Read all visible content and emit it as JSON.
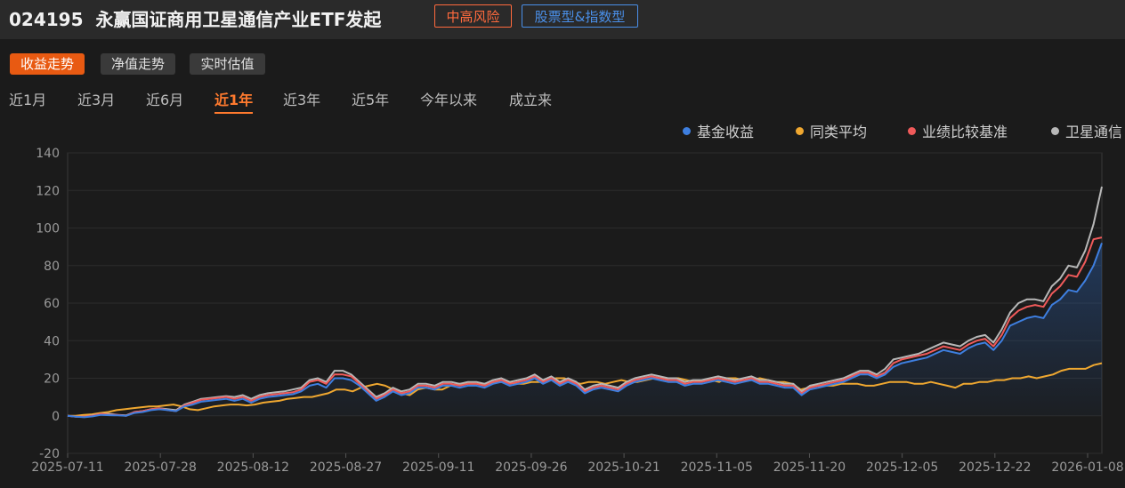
{
  "header": {
    "code": "024195",
    "name": "永赢国证商用卫星通信产业ETF发起",
    "risk_tag": "中高风险",
    "type_tag": "股票型&指数型"
  },
  "modes": [
    "收益走势",
    "净值走势",
    "实时估值"
  ],
  "active_mode": 0,
  "periods": [
    "近1月",
    "近3月",
    "近6月",
    "近1年",
    "近3年",
    "近5年",
    "今年以来",
    "成立来"
  ],
  "active_period": 3,
  "colors": {
    "fund": "#3e7fe0",
    "peer": "#f0a830",
    "benchmark": "#f05a5a",
    "index": "#b8b8b8",
    "accent": "#e85a12"
  },
  "chart_data": {
    "type": "line",
    "yticks": [
      -20,
      0,
      20,
      40,
      60,
      80,
      100,
      120,
      140
    ],
    "ylim": [
      -20,
      140
    ],
    "xticks": [
      "2025-07-11",
      "2025-07-28",
      "2025-08-12",
      "2025-08-27",
      "2025-09-11",
      "2025-09-26",
      "2025-10-21",
      "2025-11-05",
      "2025-11-20",
      "2025-12-05",
      "2025-12-22",
      "2026-01-08"
    ],
    "series": [
      {
        "name": "基金收益",
        "color": "#3e7fe0",
        "values": [
          0,
          -0.5,
          -0.8,
          -0.3,
          0.5,
          0.3,
          0.2,
          0,
          1.5,
          2,
          3,
          3.5,
          3,
          2.5,
          5,
          6,
          7.5,
          8,
          8.5,
          9,
          8,
          9,
          7,
          9,
          10,
          10.5,
          11,
          11.5,
          13,
          16,
          17,
          15,
          20,
          20,
          19,
          16,
          12,
          8,
          10,
          13,
          11,
          12,
          15,
          15,
          14,
          16,
          16,
          15,
          16,
          16,
          15,
          17,
          18,
          16,
          17,
          18,
          20,
          17,
          19,
          16,
          18,
          16,
          12,
          14,
          15,
          14,
          13,
          16,
          18,
          19,
          20,
          19,
          18,
          18,
          16,
          17,
          17,
          18,
          19,
          18,
          17,
          18,
          19,
          17,
          17,
          16,
          15,
          15,
          11,
          14,
          15,
          16,
          17,
          18,
          20,
          22,
          22,
          20,
          22,
          26,
          28,
          29,
          30,
          31,
          33,
          35,
          34,
          33,
          36,
          38,
          39,
          35,
          40,
          48,
          50,
          52,
          53,
          52,
          59,
          62,
          67,
          66,
          72,
          80,
          92
        ]
      },
      {
        "name": "同类平均",
        "color": "#f0a830",
        "values": [
          0,
          0,
          0.5,
          0.8,
          1.5,
          2,
          3,
          3.5,
          4,
          4.5,
          5,
          5,
          5.5,
          6,
          5,
          3.5,
          3,
          4,
          5,
          5.5,
          6,
          6,
          5.5,
          6,
          7,
          7.5,
          8,
          9,
          9.5,
          10,
          10,
          11,
          12,
          14,
          14,
          13,
          15,
          16,
          17,
          16,
          14,
          12,
          11,
          14,
          15,
          14,
          14,
          16,
          17,
          17,
          17,
          17,
          17,
          18,
          18,
          17,
          17,
          18,
          18,
          19,
          20,
          20,
          18,
          17,
          18,
          18,
          17,
          18,
          19,
          18,
          18,
          19,
          20,
          20,
          20,
          20,
          19,
          18,
          19,
          19,
          18,
          20,
          20,
          19,
          19,
          20,
          19,
          18,
          18,
          17,
          14,
          15,
          16,
          16,
          16,
          17,
          17,
          17,
          16,
          16,
          17,
          18,
          18,
          18,
          17,
          17,
          18,
          17,
          16,
          15,
          17,
          17,
          18,
          18,
          19,
          19,
          20,
          20,
          21,
          20,
          21,
          22,
          24,
          25,
          25,
          25,
          27,
          28
        ]
      },
      {
        "name": "业绩比较基准",
        "color": "#f05a5a",
        "values": [
          0,
          -0.5,
          -0.5,
          0,
          1,
          0.5,
          0.5,
          0,
          2,
          2.5,
          3.5,
          4,
          3,
          2.5,
          5.5,
          7,
          8.5,
          9,
          9.5,
          10,
          9,
          10,
          8,
          10,
          11,
          11.5,
          12,
          12.5,
          14,
          18,
          19,
          17,
          22,
          22,
          21,
          17,
          13,
          9,
          11,
          14,
          12,
          13,
          16,
          16,
          15,
          17,
          17,
          16,
          17,
          17,
          16,
          18,
          19,
          17,
          18,
          19,
          21,
          18,
          20,
          17,
          19,
          17,
          13,
          15,
          16,
          15,
          14,
          17,
          19,
          20,
          21,
          20,
          19,
          19,
          17,
          18,
          18,
          19,
          20,
          19,
          18,
          19,
          20,
          18,
          18,
          17,
          16,
          16,
          12,
          15,
          16,
          17,
          18,
          19,
          21,
          23,
          23,
          21,
          23,
          28,
          30,
          31,
          32,
          33,
          35,
          37,
          36,
          35,
          38,
          40,
          41,
          37,
          43,
          52,
          56,
          58,
          59,
          58,
          65,
          69,
          75,
          74,
          82,
          94,
          95
        ]
      },
      {
        "name": "卫星通信",
        "color": "#b8b8b8",
        "values": [
          0,
          -0.5,
          -0.5,
          0.2,
          1,
          1,
          0.5,
          0.2,
          2,
          2.5,
          3.5,
          4,
          3.5,
          3,
          6,
          7.5,
          9,
          9.5,
          10,
          10.5,
          10,
          11,
          9,
          11,
          12,
          12.5,
          13,
          14,
          15,
          19,
          20,
          18,
          24,
          24,
          22,
          18,
          14,
          10,
          12,
          15,
          13,
          14,
          17,
          17,
          16,
          18,
          18,
          17,
          18,
          18,
          17,
          19,
          20,
          18,
          19,
          20,
          22,
          19,
          21,
          18,
          20,
          18,
          14,
          16,
          17,
          16,
          15,
          18,
          20,
          21,
          22,
          21,
          20,
          20,
          18,
          19,
          19,
          20,
          21,
          20,
          19,
          20,
          21,
          19,
          19,
          18,
          17,
          17,
          13,
          16,
          17,
          18,
          19,
          20,
          22,
          24,
          24,
          22,
          25,
          30,
          31,
          32,
          33,
          35,
          37,
          39,
          38,
          37,
          40,
          42,
          43,
          39,
          46,
          55,
          60,
          62,
          62,
          61,
          69,
          73,
          80,
          79,
          88,
          102,
          122
        ]
      }
    ]
  }
}
